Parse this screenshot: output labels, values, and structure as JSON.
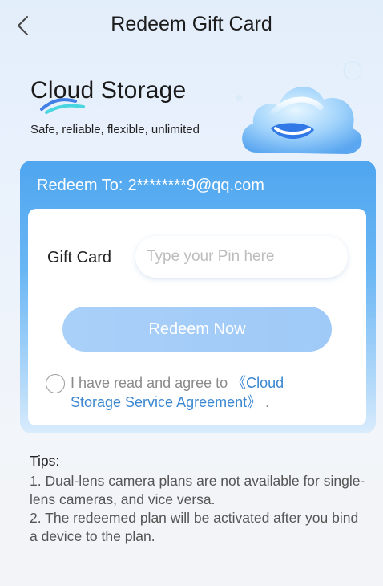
{
  "header": {
    "title": "Redeem Gift Card"
  },
  "hero": {
    "title": "Cloud Storage",
    "subtitle": "Safe, reliable, flexible, unlimited"
  },
  "card": {
    "redeem_to_label": "Redeem To:",
    "email": "2********9@qq.com",
    "gift_card_label": "Gift Card",
    "pin_placeholder": "Type your Pin here",
    "pin_value": "",
    "redeem_button": "Redeem Now",
    "agreement": {
      "checked": false,
      "prefix": "I have read and agree to ",
      "link": "《Cloud Storage Service Agreement》",
      "suffix": " ."
    }
  },
  "tips": {
    "title": "Tips:",
    "items": [
      "1. Dual-lens camera plans are not available for single-lens cameras, and vice versa.",
      "2. The redeemed plan will be activated after you bind a device to the plan."
    ]
  },
  "colors": {
    "accent": "#4fa6ef",
    "button": "#a9d0f8",
    "link": "#3b87d1"
  }
}
